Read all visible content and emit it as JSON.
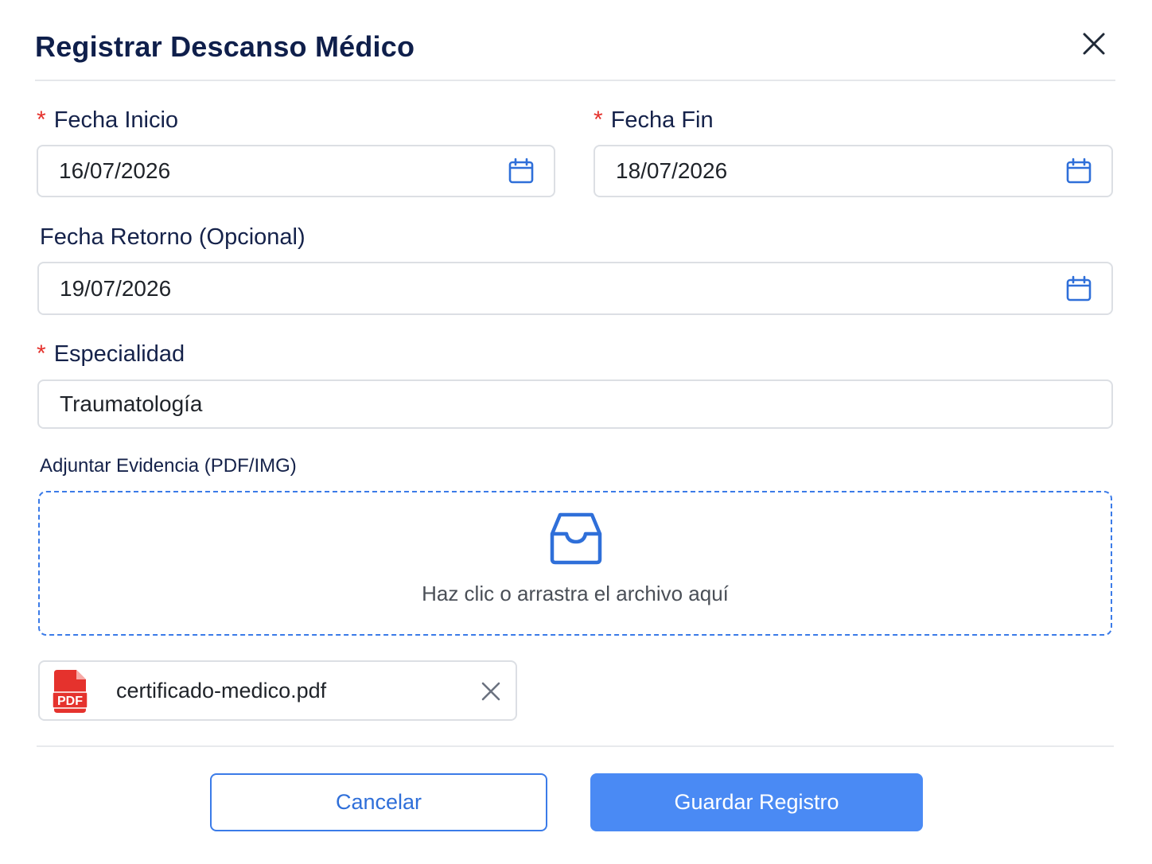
{
  "dialog": {
    "title": "Registrar Descanso Médico"
  },
  "form": {
    "required_mark": "*",
    "fecha_inicio": {
      "label": "Fecha Inicio",
      "value": "16/07/2026"
    },
    "fecha_fin": {
      "label": "Fecha Fin",
      "value": "18/07/2026"
    },
    "fecha_retorno": {
      "label": "Fecha Retorno (Opcional)",
      "value": "19/07/2026"
    },
    "especialidad": {
      "label": "Especialidad",
      "value": "Traumatología"
    },
    "evidencia": {
      "label": "Adjuntar Evidencia (PDF/IMG)",
      "dropzone_text": "Haz clic o arrastra el archivo aquí",
      "file": {
        "name": "certificado-medico.pdf",
        "badge": "PDF"
      }
    }
  },
  "footer": {
    "cancel_label": "Cancelar",
    "save_label": "Guardar Registro"
  },
  "colors": {
    "accent": "#3b7be8",
    "primary_button": "#4a8af4",
    "title": "#0f1f4b",
    "required": "#e5322d",
    "pdf_red": "#e5322d"
  },
  "icons": [
    "close-icon",
    "calendar-icon",
    "inbox-icon",
    "pdf-file-icon",
    "remove-file-icon"
  ]
}
